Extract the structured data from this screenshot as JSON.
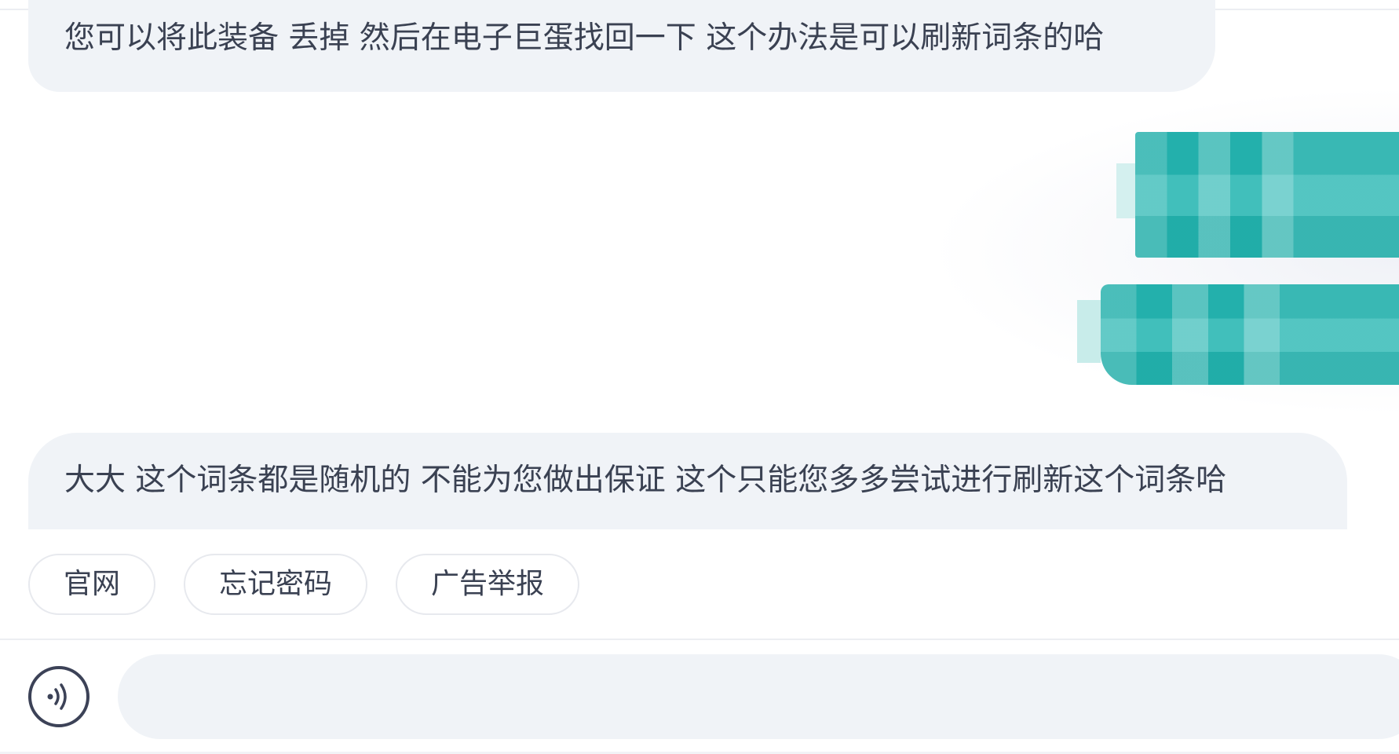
{
  "messages": {
    "received_1": "您可以将此装备 丢掉 然后在电子巨蛋找回一下 这个办法是可以刷新词条的哈",
    "received_2": "大大 这个词条都是随机的 不能为您做出保证 这个只能您多多尝试进行刷新这个词条哈"
  },
  "quick_replies": [
    "官网",
    "忘记密码",
    "广告举报"
  ],
  "composer": {
    "voice_icon": "voice-wave-icon",
    "placeholder": ""
  },
  "colors": {
    "bubble_bg": "#f0f3f7",
    "redaction": "#27b6b2",
    "text": "#3a4152"
  }
}
